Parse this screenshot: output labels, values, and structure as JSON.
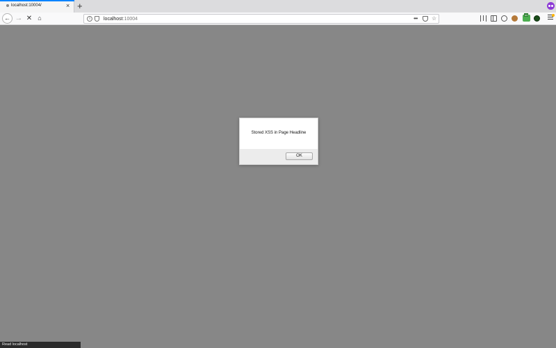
{
  "tab": {
    "title": "localhost:10004/",
    "close_glyph": "×"
  },
  "tabstrip": {
    "new_tab_glyph": "+"
  },
  "nav": {
    "back_glyph": "←",
    "forward_glyph": "→",
    "stop_glyph": "✕",
    "home_glyph": "⌂"
  },
  "urlbar": {
    "host": "localhost",
    "port": ":10004",
    "more_glyph": "•••",
    "star_glyph": "☆"
  },
  "toolbar": {
    "extension_badge": "on"
  },
  "dialog": {
    "message": "Stored XSS in Page Headline",
    "ok_label": "OK"
  },
  "status": {
    "text": "Read localhost"
  },
  "colors": {
    "page_overlay": "#878787",
    "tab_progress": "#0a84ff",
    "account_avatar": "#8e3bd6"
  }
}
